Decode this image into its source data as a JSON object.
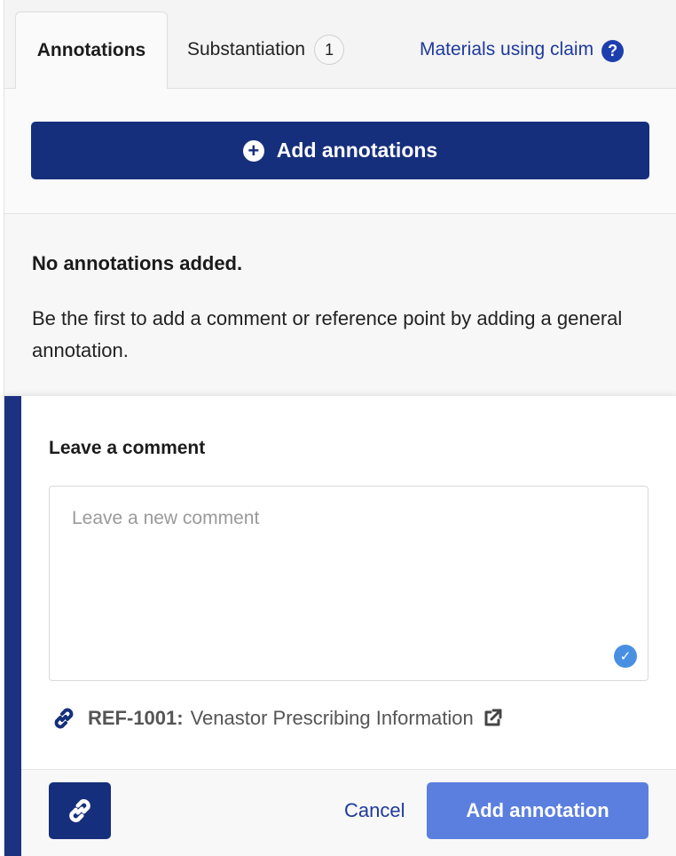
{
  "tabs": {
    "annotations_label": "Annotations",
    "substantiation_label": "Substantiation",
    "substantiation_count": "1",
    "materials_label": "Materials using claim",
    "help_glyph": "?"
  },
  "add_button": {
    "label": "Add annotations",
    "icon": "plus-circle-icon"
  },
  "empty_state": {
    "title": "No annotations added.",
    "message": "Be the first to add a comment or reference point by adding a general annotation."
  },
  "comment": {
    "title": "Leave a comment",
    "placeholder": "Leave a new comment",
    "value": ""
  },
  "reference": {
    "code": "REF-1001:",
    "name": "Venastor Prescribing Information"
  },
  "footer": {
    "cancel_label": "Cancel",
    "submit_label": "Add annotation"
  },
  "colors": {
    "primary": "#162f7c",
    "link": "#1f3a9c",
    "submit": "#5b7fdf",
    "check": "#4a90e2"
  }
}
